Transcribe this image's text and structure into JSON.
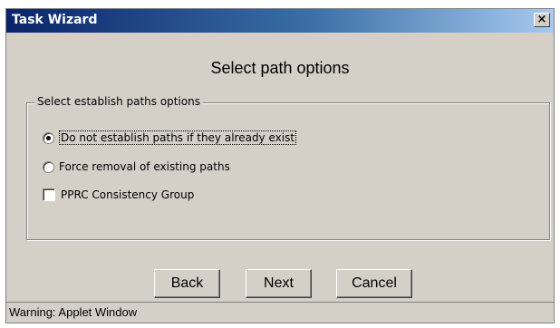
{
  "window": {
    "title": "Task Wizard",
    "close_label": "×"
  },
  "heading": "Select path options",
  "group": {
    "legend": "Select establish paths options",
    "options": [
      {
        "label": "Do not establish paths if they already exist",
        "type": "radio",
        "selected": true
      },
      {
        "label": "Force removal of existing paths",
        "type": "radio",
        "selected": false
      },
      {
        "label": "PPRC Consistency Group",
        "type": "checkbox",
        "checked": false
      }
    ]
  },
  "buttons": {
    "back": "Back",
    "next": "Next",
    "cancel": "Cancel"
  },
  "status": "Warning: Applet Window",
  "colors": {
    "titlebar_start": "#0a246a",
    "titlebar_end": "#a6caf0",
    "panel": "#d4d0c8"
  }
}
